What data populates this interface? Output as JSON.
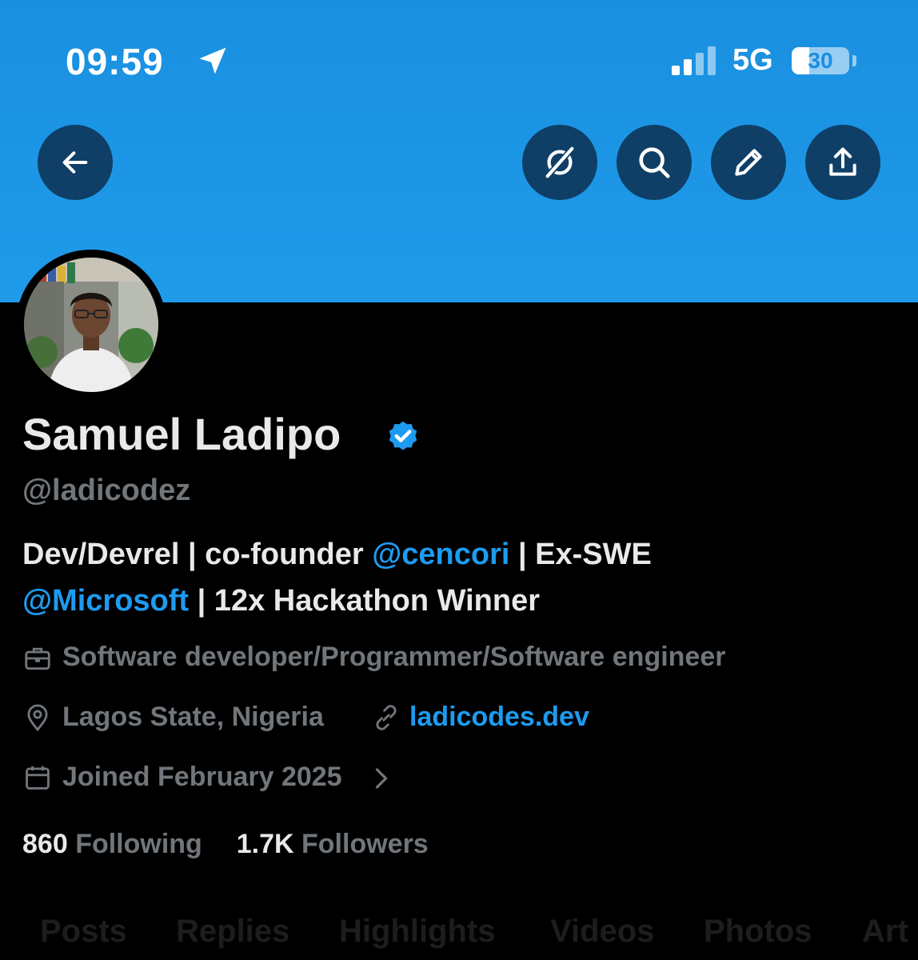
{
  "status_bar": {
    "time": "09:59",
    "network": "5G",
    "battery": "30",
    "battery_level": 0.3
  },
  "header": {
    "buttons": [
      {
        "icon": "back-arrow-icon"
      },
      {
        "icon": "grok-icon"
      },
      {
        "icon": "search-icon"
      },
      {
        "icon": "edit-pencil-icon"
      },
      {
        "icon": "share-icon"
      }
    ]
  },
  "profile": {
    "name": "Samuel Ladipo",
    "handle": "@ladicodez",
    "bio": {
      "part1": "Dev/Devrel | co-founder ",
      "mention1": "@cencori",
      "part2": " | Ex-SWE ",
      "mention2": "@Microsoft",
      "part3": " | 12x Hackathon Winner"
    },
    "category": "Software developer/Programmer/Software engineer",
    "location": "Lagos State, Nigeria",
    "website": "ladicodes.dev",
    "joined": "Joined February 2025",
    "following_count": "860",
    "following_label": "Following",
    "followers_count": "1.7K",
    "followers_label": "Followers"
  },
  "tabs": [
    "Posts",
    "Replies",
    "Highlights",
    "Videos",
    "Photos",
    "Art"
  ],
  "colors": {
    "accent": "#1d9bf0",
    "banner": "#1d9bf0",
    "text_primary": "#e7e9ea",
    "text_secondary": "#71767b",
    "background": "#000000"
  }
}
